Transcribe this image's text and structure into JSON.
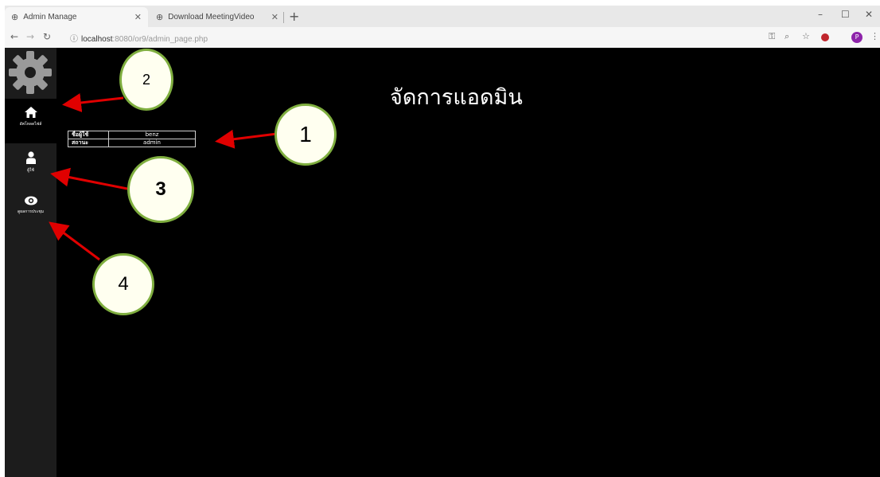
{
  "browser": {
    "tabs": [
      {
        "title": "Admin Manage",
        "active": true
      },
      {
        "title": "Download MeetingVideo",
        "active": false
      }
    ],
    "url_host": "localhost",
    "url_path": ":8080/or9/admin_page.php",
    "window_controls": [
      "–",
      "☐",
      "✕"
    ]
  },
  "sidebar": {
    "items": [
      {
        "label": "อัพโหลดไฟล์",
        "icon": "home-icon",
        "active": true
      },
      {
        "label": "ผู้ใช้",
        "icon": "user-icon",
        "active": false
      },
      {
        "label": "ดูผลการประชุม",
        "icon": "eye-icon",
        "active": false
      }
    ]
  },
  "main": {
    "title": "จัดการแอดมิน",
    "info": [
      {
        "key": "ชื่อผู้ใช้",
        "value": "benz"
      },
      {
        "key": "สถานะ",
        "value": "admin"
      }
    ]
  },
  "annotations": [
    "1",
    "2",
    "3",
    "4"
  ],
  "colors": {
    "page_bg": "#000000",
    "sidebar_bg": "#1c1c1c",
    "callout_border": "#7fae3f",
    "callout_fill": "#fffff0",
    "arrow": "#e00000"
  }
}
